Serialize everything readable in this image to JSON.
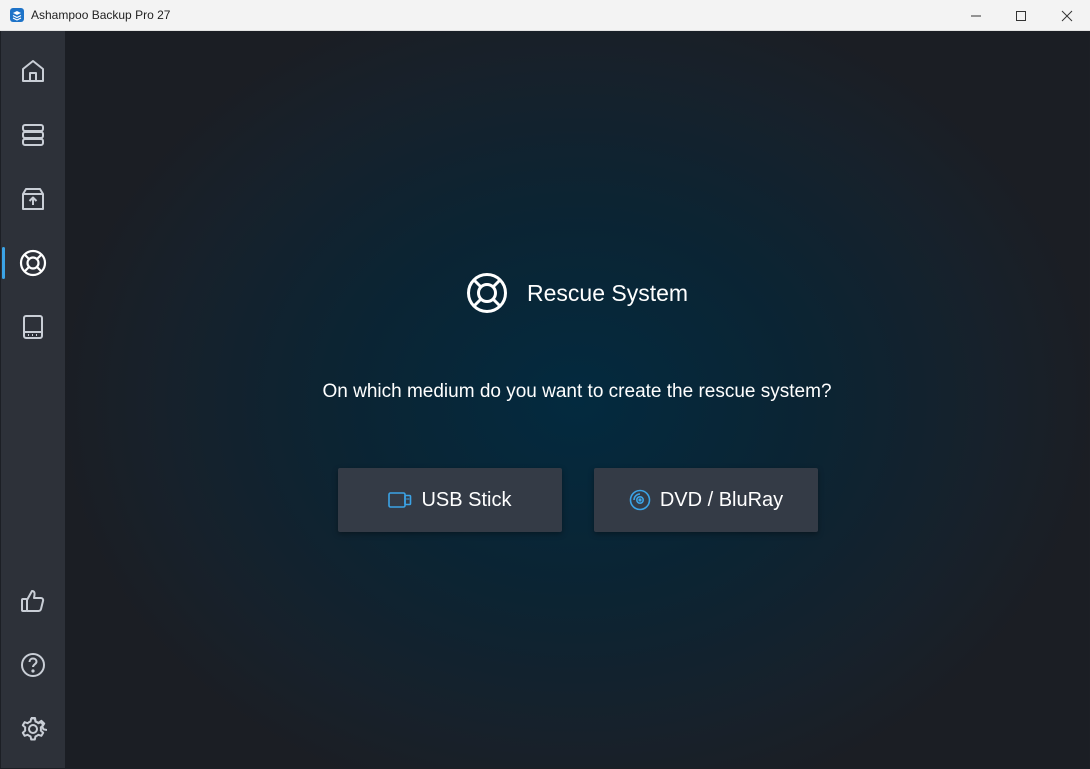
{
  "window": {
    "title": "Ashampoo Backup Pro 27"
  },
  "sidebar": {
    "items": [
      {
        "icon": "home-icon",
        "active": false
      },
      {
        "icon": "backup-plans-icon",
        "active": false
      },
      {
        "icon": "restore-box-icon",
        "active": false
      },
      {
        "icon": "lifebuoy-icon",
        "active": true
      },
      {
        "icon": "drive-icon",
        "active": false
      }
    ],
    "bottom_items": [
      {
        "icon": "thumbs-up-icon"
      },
      {
        "icon": "help-icon"
      },
      {
        "icon": "gear-icon"
      }
    ]
  },
  "main": {
    "title": "Rescue System",
    "question": "On which medium do you want to create the rescue system?",
    "options": [
      {
        "label": "USB Stick",
        "icon": "usb-stick-icon"
      },
      {
        "label": "DVD / BluRay",
        "icon": "disc-icon"
      }
    ]
  },
  "colors": {
    "accent": "#3ba3e6",
    "sidebar_bg": "#2d3139",
    "button_bg": "#343b46",
    "titlebar_bg": "#f3f3f3"
  }
}
